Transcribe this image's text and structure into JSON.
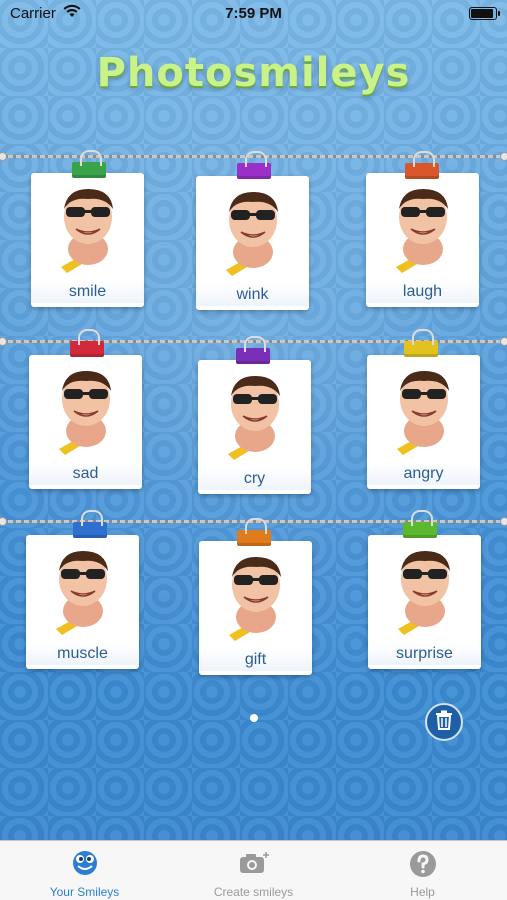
{
  "status": {
    "carrier": "Carrier",
    "time": "7:59 PM"
  },
  "app": {
    "title": "Photosmileys"
  },
  "smileys": [
    {
      "label": "smile",
      "clip_color": "#3aa34a"
    },
    {
      "label": "wink",
      "clip_color": "#9b2fc8"
    },
    {
      "label": "laugh",
      "clip_color": "#d9572a"
    },
    {
      "label": "sad",
      "clip_color": "#d22a3a"
    },
    {
      "label": "cry",
      "clip_color": "#7a2fb8"
    },
    {
      "label": "angry",
      "clip_color": "#e2c21f"
    },
    {
      "label": "muscle",
      "clip_color": "#2f6fcf"
    },
    {
      "label": "gift",
      "clip_color": "#e07a1f"
    },
    {
      "label": "surprise",
      "clip_color": "#5bb82f"
    }
  ],
  "tabs": [
    {
      "label": "Your Smileys",
      "icon": "smiley-icon",
      "active": true
    },
    {
      "label": "Create smileys",
      "icon": "camera-icon",
      "active": false
    },
    {
      "label": "Help",
      "icon": "help-icon",
      "active": false
    }
  ],
  "colors": {
    "accent": "#2a7fd4",
    "inactive": "#9a9a9a",
    "label": "#2b5d95"
  }
}
